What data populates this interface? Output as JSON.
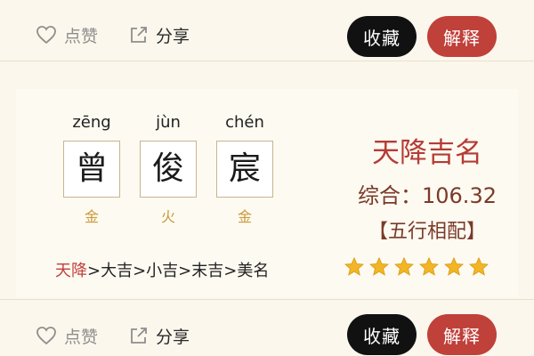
{
  "top_bar": {
    "like_label": "点赞",
    "share_label": "分享",
    "collect_label": "收藏",
    "explain_label": "解释"
  },
  "name_card": {
    "characters": [
      {
        "pinyin": "zēng",
        "char": "曾",
        "element": "金"
      },
      {
        "pinyin": "jùn",
        "char": "俊",
        "element": "火"
      },
      {
        "pinyin": "chén",
        "char": "宸",
        "element": "金"
      }
    ],
    "flow": {
      "highlight": "天降",
      "rest": ">大吉>小吉>末吉>美名"
    },
    "tier": "天降吉名",
    "score_label": "综合：",
    "score_value": "106.32",
    "match": "【五行相配】",
    "star_rating": 6,
    "star_max": 6
  },
  "bottom_bar": {
    "like_label": "点赞",
    "share_label": "分享",
    "collect_label": "收藏",
    "explain_label": "解释"
  },
  "colors": {
    "background": "#fbf7ec",
    "accent_red": "#c0403a",
    "collect_black": "#111111",
    "element_gold": "#c99a3a",
    "star_gold": "#f2b526"
  },
  "icons": [
    "heart-icon",
    "share-icon",
    "star-icon"
  ]
}
